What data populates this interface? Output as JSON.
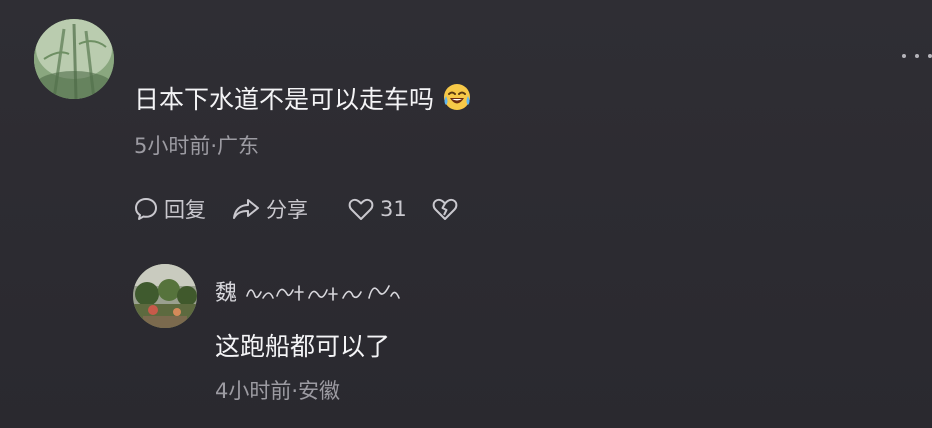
{
  "colors": {
    "background": "#2c2b31",
    "primary_text": "#f4f4f6",
    "secondary_text": "#9c9ba2",
    "action_text": "#c9c8ce"
  },
  "comment": {
    "text": "日本下水道不是可以走车吗",
    "emoji": "laughing-tears-emoji",
    "meta": "5小时前·广东",
    "actions": {
      "reply_label": "回复",
      "share_label": "分享",
      "like_count": "31"
    },
    "icons": [
      "comment-bubble-icon",
      "share-arrow-icon",
      "heart-icon",
      "broken-heart-icon",
      "more-dots-icon"
    ]
  },
  "reply": {
    "username": "魏",
    "username_decoration": "decorative-script-glyphs",
    "text": "这跑船都可以了",
    "meta": "4小时前·安徽"
  }
}
